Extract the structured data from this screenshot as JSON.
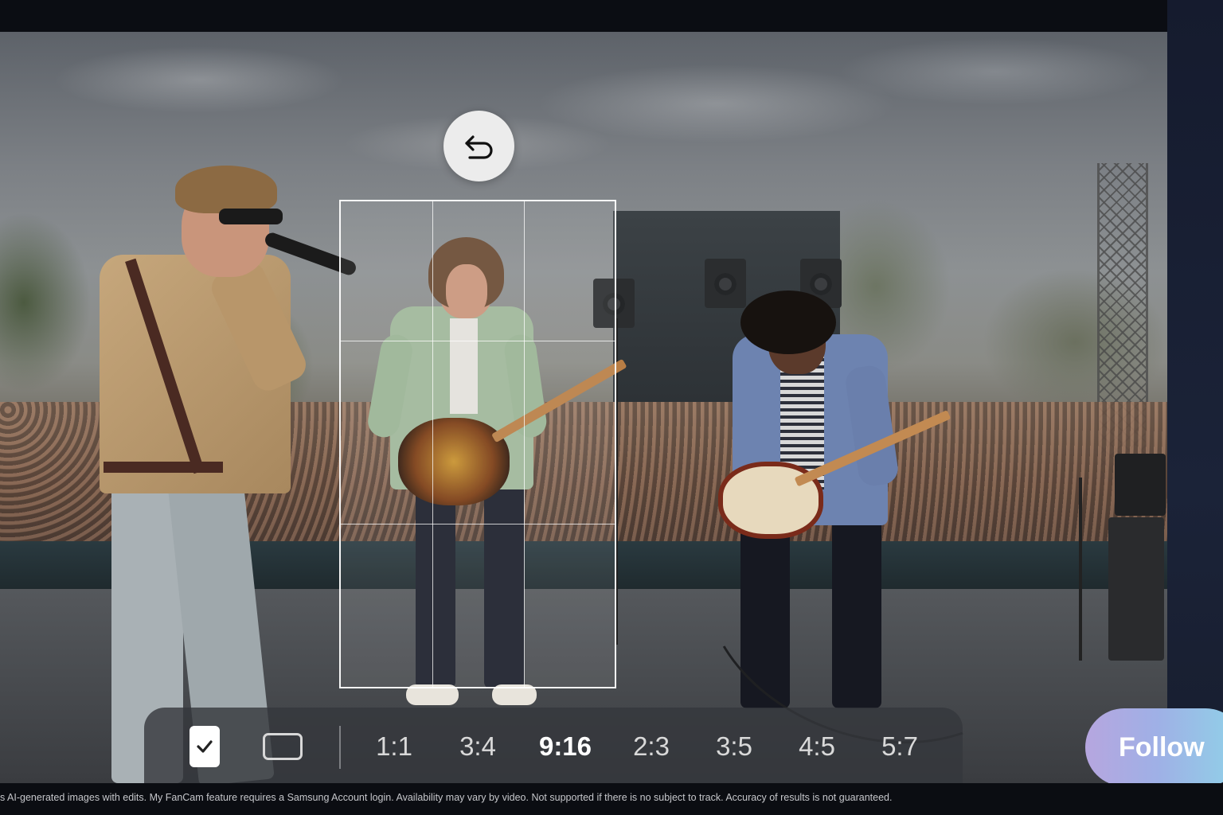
{
  "undo": {
    "icon": "undo-icon"
  },
  "toolbar": {
    "confirm_icon": "check-icon",
    "freeform_icon": "rectangle-icon",
    "ratios": [
      "1:1",
      "3:4",
      "9:16",
      "2:3",
      "3:5",
      "4:5",
      "5:7"
    ],
    "selected_ratio": "9:16"
  },
  "follow_label": "Follow",
  "disclaimer": "s AI-generated images with edits. My FanCam feature requires a Samsung Account login. Availability may vary by video. Not supported if there is no subject to track. Accuracy of results is not guaranteed.",
  "colors": {
    "accent_gradient_start": "#b6a6df",
    "accent_gradient_end": "#8fd3e8",
    "toolbar_bg": "#34373c"
  }
}
